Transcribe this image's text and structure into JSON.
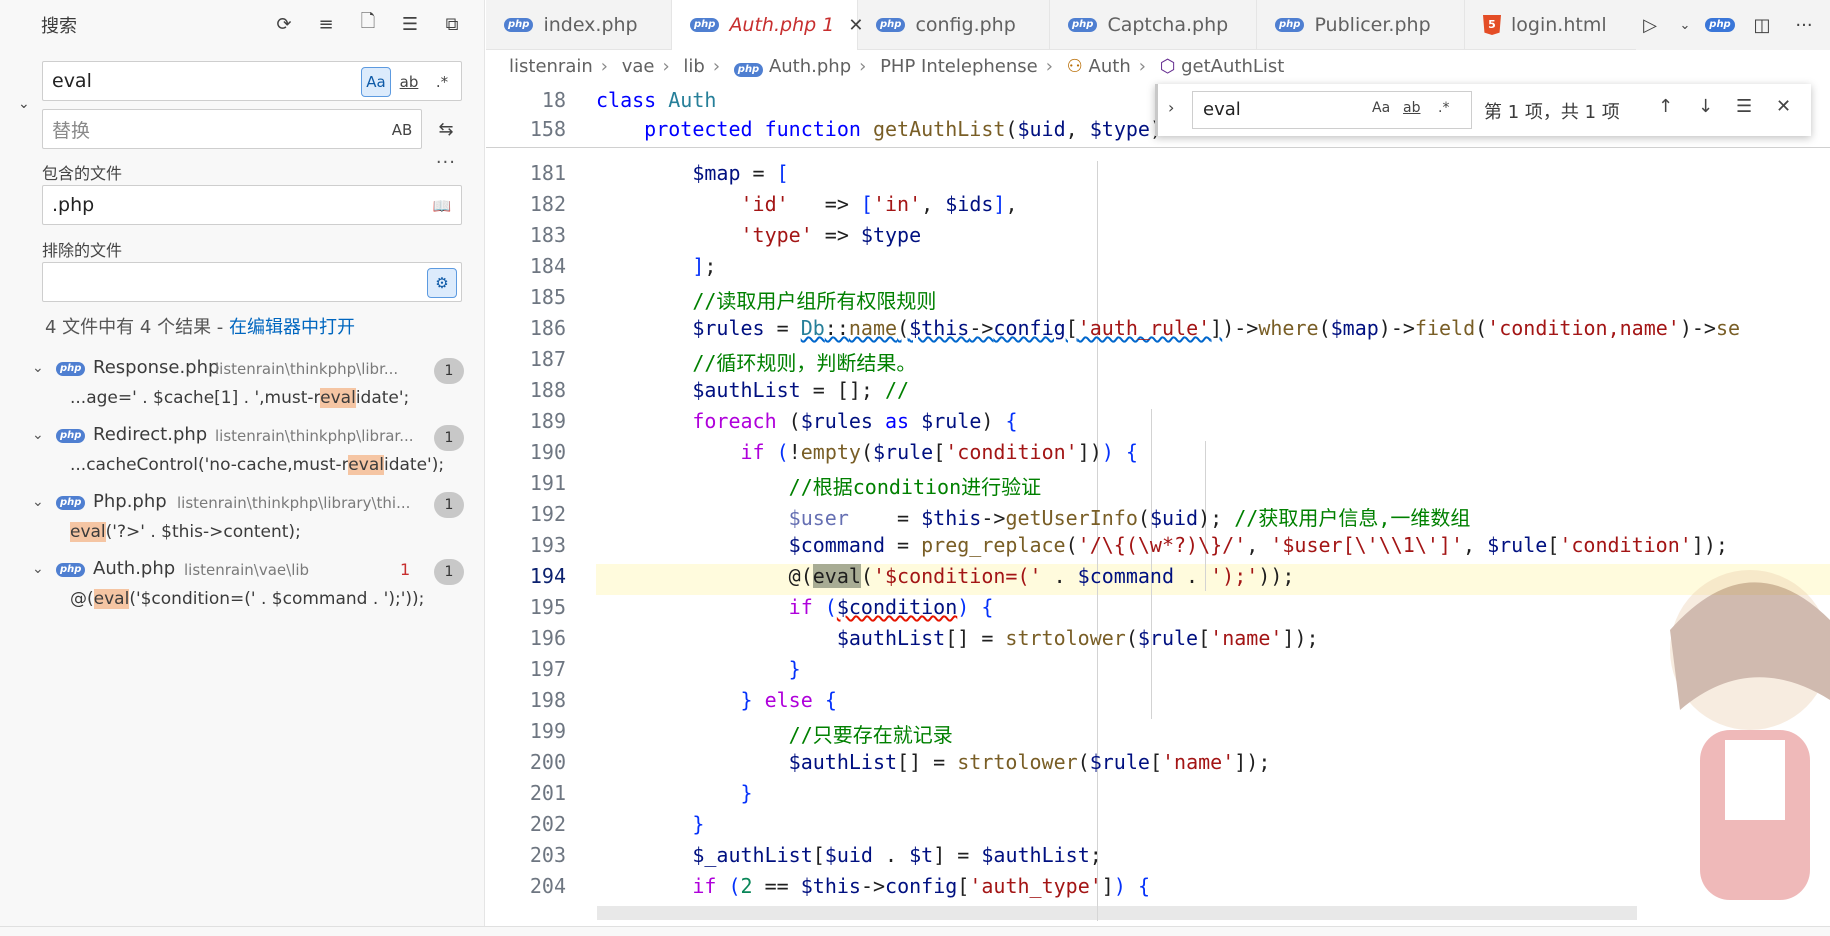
{
  "sidebar": {
    "title": "搜索",
    "search_value": "eval",
    "replace_placeholder": "替换",
    "include_label": "包含的文件",
    "include_value": ".php",
    "exclude_label": "排除的文件",
    "exclude_value": "",
    "summary_text": "4 文件中有 4 个结果 - ",
    "summary_link": "在编辑器中打开",
    "opt_case": "Aa",
    "opt_word": "ab",
    "opt_regex": ".*",
    "opt_preserve": "AB",
    "results": [
      {
        "file": "Response.php",
        "path": "listenrain\\thinkphp\\libr...",
        "count": "1",
        "pre": "...age=' . $cache[1] . ',must-r",
        "hit": "eval",
        "post": "idate';"
      },
      {
        "file": "Redirect.php",
        "path": "listenrain\\thinkphp\\librar...",
        "count": "1",
        "pre": "...cacheControl('no-cache,must-r",
        "hit": "eval",
        "post": "idate');"
      },
      {
        "file": "Php.php",
        "path": "listenrain\\thinkphp\\library\\thi...",
        "count": "1",
        "pre": "",
        "hit": "eval",
        "post": "('?>' . $this->content);"
      },
      {
        "file": "Auth.php",
        "path": "listenrain\\vae\\lib",
        "problems": "1",
        "count": "1",
        "pre": "@(",
        "hit": "eval",
        "post": "('$condition=(' . $command . ');'));"
      }
    ]
  },
  "tabs": [
    {
      "label": "index.php",
      "icon": "php"
    },
    {
      "label": "Auth.php 1",
      "icon": "php",
      "active": true
    },
    {
      "label": "config.php",
      "icon": "php"
    },
    {
      "label": "Captcha.php",
      "icon": "php"
    },
    {
      "label": "Publicer.php",
      "icon": "php"
    },
    {
      "label": "login.html",
      "icon": "html5"
    }
  ],
  "breadcrumb": [
    "listenrain",
    "vae",
    "lib",
    "Auth.php",
    "PHP Intelephense",
    "Auth",
    "getAuthList"
  ],
  "find_widget": {
    "value": "eval",
    "result": "第 1 项，共 1 项",
    "opt_case": "Aa",
    "opt_word": "ab",
    "opt_regex": ".*"
  },
  "sticky": [
    {
      "ln": "18",
      "code": "class Auth"
    },
    {
      "ln": "158",
      "code": "    protected function getAuthList($uid, $type)"
    }
  ],
  "line_numbers": [
    "181",
    "182",
    "183",
    "184",
    "185",
    "186",
    "187",
    "188",
    "189",
    "190",
    "191",
    "192",
    "193",
    "194",
    "195",
    "196",
    "197",
    "198",
    "199",
    "200",
    "201",
    "202",
    "203",
    "204"
  ],
  "code_lines": [
    "        $map = [",
    "            'id'   => ['in', $ids],",
    "            'type' => $type",
    "        ];",
    "        //读取用户组所有权限规则",
    "        $rules = Db::name($this->config['auth_rule'])->where($map)->field('condition,name')->se",
    "        //循环规则，判断结果。",
    "        $authList = []; //",
    "        foreach ($rules as $rule) {",
    "            if (!empty($rule['condition'])) {",
    "                //根据condition进行验证",
    "                $user    = $this->getUserInfo($uid); //获取用户信息,一维数组",
    "                $command = preg_replace('/\\{(\\w*?)\\}/', '$user[\\'\\\\1\\']', $rule['condition']);",
    "                @(eval('$condition=(' . $command . ');'));",
    "                if ($condition) {",
    "                    $authList[] = strtolower($rule['name']);",
    "                }",
    "            } else {",
    "                //只要存在就记录",
    "                $authList[] = strtolower($rule['name']);",
    "            }",
    "        }",
    "        $_authList[$uid . $t] = $authList;",
    "        if (2 == $this->config['auth_type']) {"
  ],
  "current_line": "194",
  "colors": {
    "accent": "#0066bf",
    "error": "#c72e2e",
    "highlight": "#f5c5a3"
  }
}
